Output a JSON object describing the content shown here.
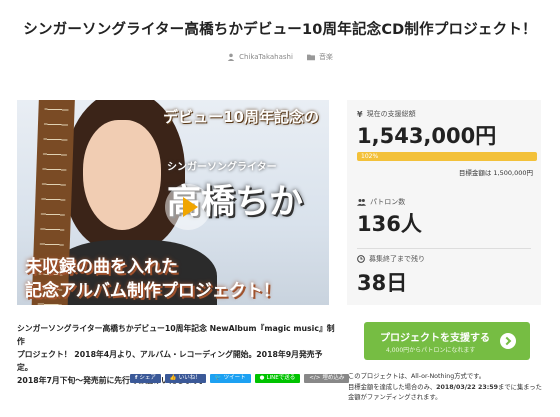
{
  "title": "シンガーソングライター高橋ちかデビュー10周年記念CD制作プロジェクト！",
  "meta": {
    "author": "ChikaTakahashi",
    "category": "音楽"
  },
  "hero": {
    "banner_top": "デビュー10周年記念の",
    "subtitle": "シンガーソングライター",
    "name": "高橋ちか",
    "line1": "未収録の曲を入れた",
    "line2": "記念アルバム制作プロジェクト！"
  },
  "panel": {
    "raised_label": "現在の支援総額",
    "raised_value": "1,543,000円",
    "progress_text": "102%",
    "progress_value": 1.0,
    "target_text": "目標金額は 1,500,000円",
    "backers_label": "パトロン数",
    "backers_value": "136人",
    "days_label": "募集終了まで残り",
    "days_value": "38日"
  },
  "description": [
    "シンガーソングライター高橋ちかデビュー10周年記念 NewAlbum『magic music』制作",
    "プロジェクト！ 2018年4月より、アルバム・レコーディング開始。2018年9月発売予定。",
    "2018年7月下旬〜発売前に先行でお届けいたします。"
  ],
  "share": {
    "facebook": "シェア",
    "like": "いいね！",
    "tweet": "ツイート",
    "line": "LINEで送る",
    "embed": "埋め込み"
  },
  "cta": {
    "main": "プロジェクトを支援する",
    "sub": "4,000円からパトロンになれます"
  },
  "note": {
    "line1": "このプロジェクトは、All-or-Nothing方式です。",
    "line2_pre": "目標金額を達成した場合のみ、",
    "line2_date": "2018/03/22 23:59",
    "line2_post": "までに集まった",
    "line3": "金額がファンディングされます。"
  },
  "colors": {
    "progress": "#f3c13a",
    "cta": "#76bd43",
    "facebook": "#3b5998",
    "twitter": "#1da1f2",
    "line": "#00c300",
    "embed": "#888888"
  }
}
